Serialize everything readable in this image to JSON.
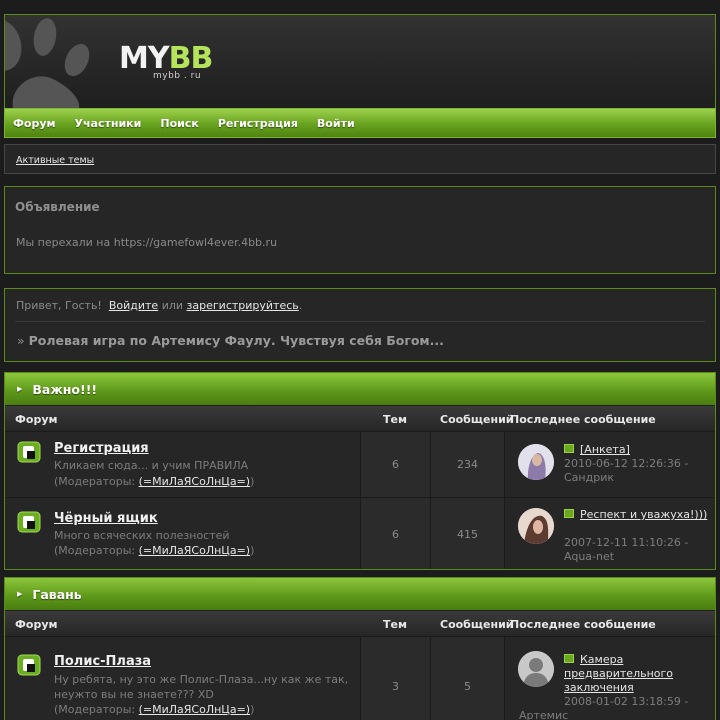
{
  "logo": {
    "main": "MY",
    "accent": "BB",
    "sub": "mybb",
    "sub_dot": ".",
    "sub_tld": "ru"
  },
  "nav": [
    "Форум",
    "Участники",
    "Поиск",
    "Регистрация",
    "Войти"
  ],
  "subnav": {
    "active_topics": "Активные темы"
  },
  "announcement": {
    "title": "Объявление",
    "text": "Мы перехали на https://gamefowl4ever.4bb.ru"
  },
  "welcome": {
    "greeting": "Привет, Гость!",
    "login": "Войдите",
    "or": "или",
    "register": "зарегистрируйтесь",
    "end": ".",
    "path_prefix": "»",
    "path_title": "Ролевая игра по Артемису Фаулу. Чувствуя себя Богом..."
  },
  "columns": {
    "forum": "Форум",
    "topics": "Тем",
    "posts": "Сообщений",
    "last": "Последнее сообщение"
  },
  "categories": [
    {
      "title": "Важно!!!",
      "forums": [
        {
          "title": "Регистрация",
          "desc": "Кликаем сюда... и учим ПРАВИЛА",
          "mods_label": "(Модераторы:",
          "mods_name": "(=МиЛаЯСоЛнЦа=)",
          "mods_close": ")",
          "topics": "6",
          "posts": "234",
          "last_title": "[Анкета]",
          "last_date": "2010-06-12 12:26:36 -",
          "last_author": "Сандрик"
        },
        {
          "title": "Чёрный ящик",
          "desc": "Много всяческих полезностей",
          "mods_label": "(Модераторы:",
          "mods_name": "(=МиЛаЯСоЛнЦа=)",
          "mods_close": ")",
          "topics": "6",
          "posts": "415",
          "last_title": "Респект и уважуха!)))",
          "last_date": "2007-12-11 11:10:26 -",
          "last_author": "Aqua-net"
        }
      ]
    },
    {
      "title": "Гавань",
      "forums": [
        {
          "title": "Полис-Плаза",
          "desc": "Ну ребята, ну это же Полис-Плаза...ну как же так, неужто вы не знаете??? XD",
          "mods_label": "(Модераторы:",
          "mods_name": "(=МиЛаЯСоЛнЦа=)",
          "mods_close": ")",
          "topics": "3",
          "posts": "5",
          "last_title": "Камера предварительного заключения",
          "last_date": "2008-01-02 13:18:59 -",
          "last_author": "Артемис"
        }
      ]
    }
  ],
  "colors": {
    "accent": "#7cb535",
    "background": "#1c1c1c",
    "panel": "#262626"
  }
}
